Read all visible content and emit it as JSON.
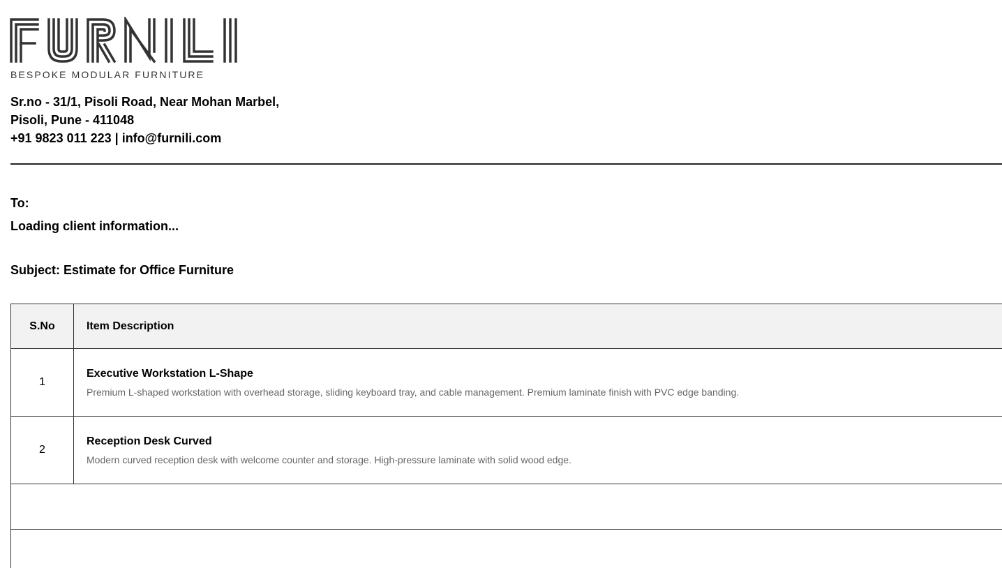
{
  "brand": {
    "logo_text": "FURNILI",
    "tagline": "BESPOKE MODULAR FURNITURE"
  },
  "company": {
    "address_line1": "Sr.no - 31/1, Pisoli Road, Near Mohan Marbel,",
    "address_line2": "Pisoli, Pune - 411048",
    "contact": "+91 9823 011 223 | info@furnili.com"
  },
  "recipient": {
    "label": "To:",
    "client": "Loading client information..."
  },
  "subject": {
    "text": "Subject: Estimate for Office Furniture"
  },
  "table": {
    "columns": [
      "S.No",
      "Item Description"
    ],
    "rows": [
      {
        "sno": "1",
        "name": "Executive Workstation L-Shape",
        "description": "Premium L-shaped workstation with overhead storage, sliding keyboard tray, and cable management. Premium laminate finish with PVC edge banding."
      },
      {
        "sno": "2",
        "name": "Reception Desk Curved",
        "description": "Modern curved reception desk with welcome counter and storage. High-pressure laminate with solid wood edge."
      }
    ]
  },
  "colors": {
    "logo": "#333333",
    "header_bg": "#f2f2f2",
    "muted_text": "#666666"
  }
}
